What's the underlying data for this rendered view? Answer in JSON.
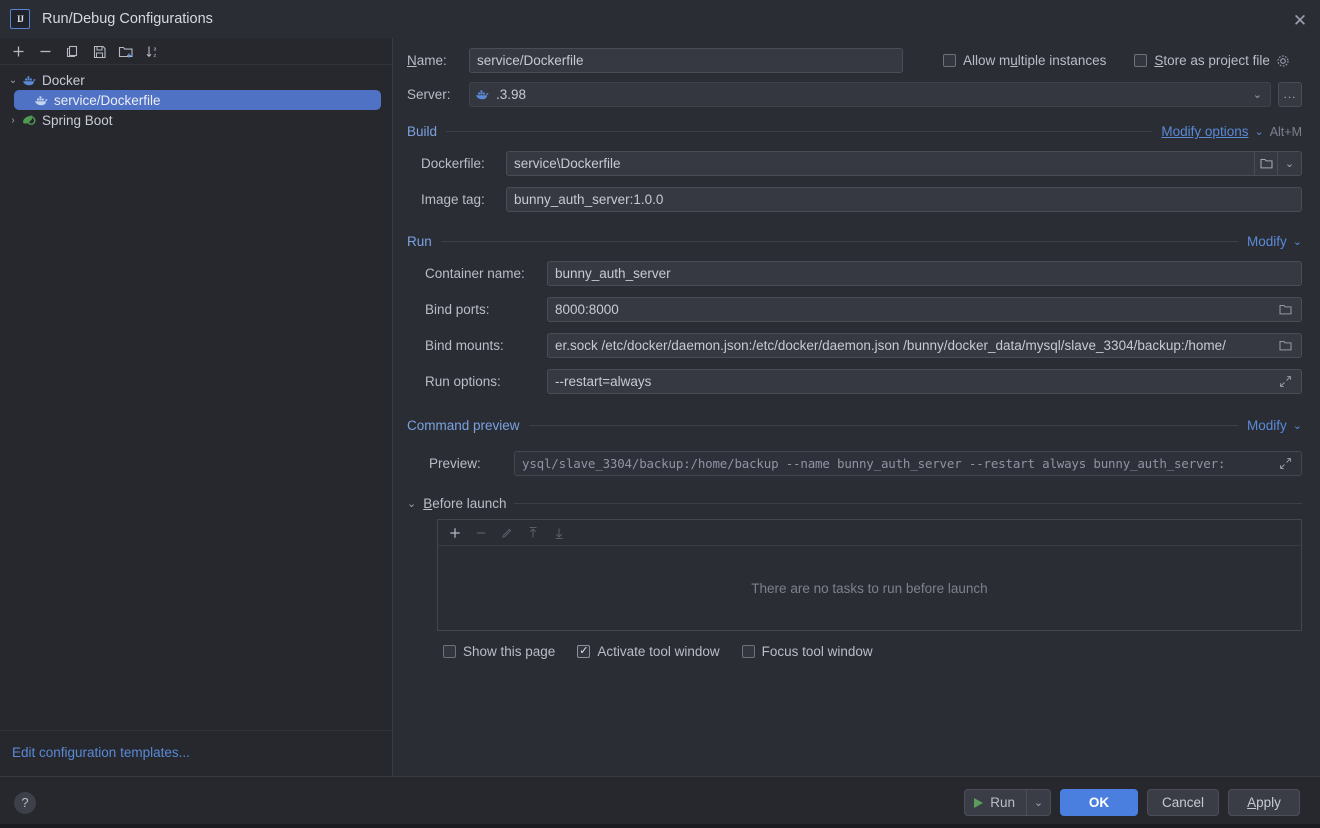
{
  "window": {
    "title": "Run/Debug Configurations",
    "logo_text": "IJ",
    "close_icon": "close-icon"
  },
  "sidebar": {
    "toolbar": [
      {
        "name": "add-configuration-button",
        "icon": "plus-icon"
      },
      {
        "name": "remove-configuration-button",
        "icon": "minus-icon"
      },
      {
        "name": "copy-configuration-button",
        "icon": "copy-icon"
      },
      {
        "name": "save-configuration-button",
        "icon": "save-icon"
      },
      {
        "name": "new-folder-button",
        "icon": "folder-add-icon"
      },
      {
        "name": "sort-configurations-button",
        "icon": "sort-alphabetical-icon"
      }
    ],
    "tree": [
      {
        "label": "Docker",
        "icon": "docker-whale-icon",
        "expanded": true,
        "level": 0,
        "selected": false
      },
      {
        "label": "service/Dockerfile",
        "icon": "docker-whale-icon",
        "level": 1,
        "selected": true
      },
      {
        "label": "Spring Boot",
        "icon": "spring-leaf-icon",
        "expanded": false,
        "level": 0,
        "selected": false
      }
    ],
    "edit_templates_link": "Edit configuration templates..."
  },
  "form": {
    "name_label": "Name:",
    "name_value": "service/Dockerfile",
    "allow_multiple_instances_label": "Allow multiple instances",
    "allow_multiple_instances_checked": false,
    "store_as_project_file_label": "Store as project file",
    "store_as_project_file_checked": false,
    "store_gear_icon": "gear-icon",
    "server_label": "Server:",
    "server_value": ".3.98",
    "server_icon": "docker-whale-icon",
    "server_browse_label": "..."
  },
  "build": {
    "section_title": "Build",
    "modify_options_label": "Modify options",
    "modify_options_shortcut": "Alt+M",
    "dockerfile_label": "Dockerfile:",
    "dockerfile_value": "service\\Dockerfile",
    "image_tag_label": "Image tag:",
    "image_tag_value": "bunny_auth_server:1.0.0"
  },
  "run": {
    "section_title": "Run",
    "modify_label": "Modify",
    "container_name_label": "Container name:",
    "container_name_value": "bunny_auth_server",
    "bind_ports_label": "Bind ports:",
    "bind_ports_value": "8000:8000",
    "bind_mounts_label": "Bind mounts:",
    "bind_mounts_value": "er.sock  /etc/docker/daemon.json:/etc/docker/daemon.json  /bunny/docker_data/mysql/slave_3304/backup:/home/",
    "run_options_label": "Run options:",
    "run_options_value": "--restart=always"
  },
  "command_preview": {
    "section_title": "Command preview",
    "modify_label": "Modify",
    "preview_label": "Preview:",
    "preview_value": "ysql/slave_3304/backup:/home/backup --name bunny_auth_server --restart always bunny_auth_server:"
  },
  "before_launch": {
    "section_title": "Before launch",
    "toolbar": [
      {
        "name": "add-task-button",
        "icon": "plus-icon",
        "enabled": true
      },
      {
        "name": "remove-task-button",
        "icon": "minus-icon",
        "enabled": false
      },
      {
        "name": "edit-task-button",
        "icon": "pencil-icon",
        "enabled": false
      },
      {
        "name": "move-task-up-button",
        "icon": "arrow-up-icon",
        "enabled": false
      },
      {
        "name": "move-task-down-button",
        "icon": "arrow-down-icon",
        "enabled": false
      }
    ],
    "empty_text": "There are no tasks to run before launch",
    "show_this_page_label": "Show this page",
    "show_this_page_checked": false,
    "activate_tool_window_label": "Activate tool window",
    "activate_tool_window_checked": true,
    "focus_tool_window_label": "Focus tool window",
    "focus_tool_window_checked": false
  },
  "footer": {
    "help_label": "?",
    "run_label": "Run",
    "ok_label": "OK",
    "cancel_label": "Cancel",
    "apply_label": "Apply"
  },
  "colors": {
    "accent_blue": "#4a7fe0",
    "link_blue": "#5a8ad6",
    "section_blue": "#7aa2e0",
    "selection_blue": "#4f72c4",
    "run_green": "#5c9c5c",
    "dialog_bg": "#2b2d35",
    "panel_bg": "#26282e"
  }
}
